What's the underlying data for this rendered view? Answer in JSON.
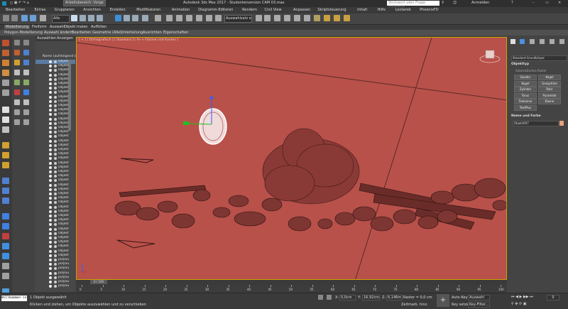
{
  "titlebar": {
    "workspace": "Arbeitsbereich: Vorge",
    "title": "Autodesk 3ds Max 2017 - Studentenversion   CAM 03.max",
    "search_placeholder": "Stichwort oder Frage eingeben",
    "login": "Anmelden"
  },
  "menubar": [
    "Bearbeiten",
    "Extras",
    "Gruppieren",
    "Ansichten",
    "Erstellen",
    "Modifikatoren",
    "Animation",
    "Diagramm-Editoren",
    "Rendern",
    "Civil View",
    "Anpassen",
    "Skriptsteuerung",
    "Inhalt",
    "Hilfe",
    "Lockerek",
    "PhoenixFD"
  ],
  "toolbar": {
    "filter": "Alle",
    "selection_set": "Auswahlsatz erstell"
  },
  "ribbon": {
    "tabs": [
      "Modellierung",
      "Freiform",
      "Auswahl",
      "Objekt malen",
      "Auffüllen"
    ],
    "subtools": [
      "Polygon-Modellierung",
      "Auswahl ändern",
      "Bearbeiten",
      "Geometrie (Alle)",
      "Unterteilung",
      "Ausrichten",
      "Eigenschaften"
    ]
  },
  "explorer": {
    "tabs": [
      "Auswählen",
      "Anzeigen"
    ],
    "header": "Name (aufsteigend s",
    "rows": [
      "Objekt",
      "Objekt",
      "Objekt",
      "Objekt",
      "Objekt",
      "Objekt",
      "Objekt",
      "Objekt",
      "Objekt",
      "Objekt",
      "Objekt",
      "Objekt",
      "Objekt",
      "Objekt",
      "Objekt",
      "Objekt",
      "Objekt",
      "Objekt",
      "Objekt",
      "Objekt",
      "Objekt",
      "Objekt",
      "Objekt",
      "Objekt",
      "Objekt",
      "Objekt",
      "Objekt",
      "Objekt",
      "Objekt",
      "Objekt",
      "Objekt",
      "Objekt",
      "Objekt",
      "Objekt",
      "Objekt",
      "Objekt",
      "Objekt",
      "Objekt",
      "Objekt",
      "Objekt",
      "Objekt",
      "Objekt",
      "Objekt",
      "Objekt",
      "Objekt",
      "polySu",
      "polySu",
      "polySu",
      "polySu",
      "polySu",
      "polySu",
      "polySu"
    ]
  },
  "viewport": {
    "label": "[ + ] [ Orthografisch ] [ Standard ] [ Fe + Flächen mit Kanten ]",
    "bg_color": "#b8514a"
  },
  "rightpanel": {
    "dropdown": "Standard-Grundkörper",
    "section_objtype": "Objekttyp",
    "autogrid": "Automatisches Raster",
    "buttons": [
      "Quader",
      "Kegel",
      "Kugel",
      "Geosphäre",
      "Zylinder",
      "Rohr",
      "Torus",
      "Pyramide",
      "Teekanne",
      "Ebene",
      "TextPlus"
    ],
    "section_name": "Name und Farbe",
    "object_name": "Objekt007",
    "swatch_color": "#e8a07a"
  },
  "timeline": {
    "slider": "0 / 100",
    "ticks": [
      "0",
      "5",
      "10",
      "15",
      "20",
      "25",
      "30",
      "35",
      "40",
      "45",
      "50",
      "55",
      "60",
      "65",
      "70",
      "75",
      "80",
      "85",
      "90",
      "95",
      "100"
    ]
  },
  "status": {
    "maxscript": "Willkommen in",
    "line1": "1 Objekt ausgewählt",
    "line2": "Klicken und ziehen, um Objekte auszuwählen und zu verschieben",
    "x": "0,0cm",
    "y": "16,92cm",
    "z": "6,146m",
    "grid": "Raster = 0,0 cm",
    "addtime": "Zeitmark. hinz.",
    "autokey": "Auto-Key",
    "auswahl": "Auswahl",
    "setkey": "Key setzen",
    "keyfilter": "Key-Filter..."
  }
}
